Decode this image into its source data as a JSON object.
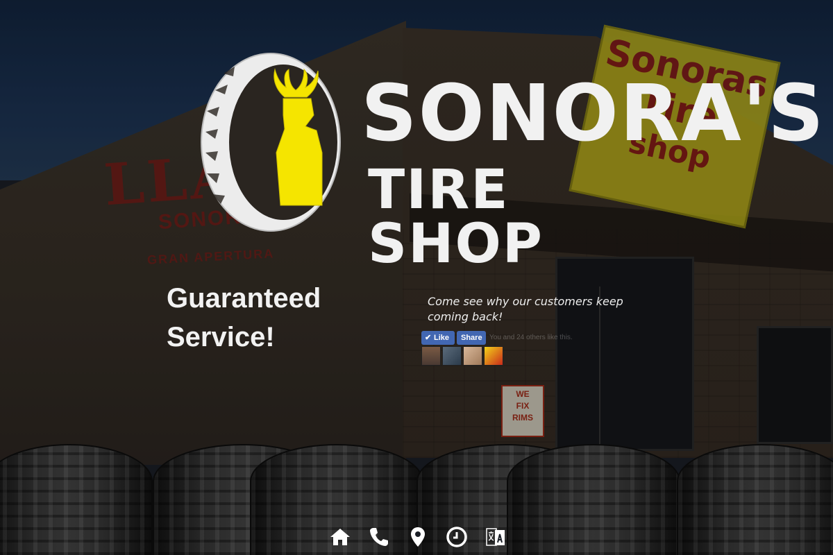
{
  "brand": {
    "name_line1": "SONORA'S",
    "name_line2": "TIRE SHOP",
    "accent_color": "#f5e500",
    "text_color": "#f1f1f1"
  },
  "background_text": {
    "wall_title": "LLAN",
    "wall_subtitle": "SONOR",
    "wall_note": "GRAN APERTURA",
    "sign_lines": [
      "Sonoras",
      "Tire",
      "shop"
    ],
    "rims_sign": [
      "WE",
      "FIX",
      "RIMS"
    ]
  },
  "hero": {
    "headline_line1": "Guaranteed",
    "headline_line2": "Service!",
    "tagline": "Come see why our customers keep coming back!"
  },
  "facebook": {
    "like_label": "Like",
    "share_label": "Share",
    "count_text": "You and 24 others like this.",
    "brand_color": "#4267b2"
  },
  "nav": {
    "items": [
      {
        "icon": "home-icon",
        "label": "Home"
      },
      {
        "icon": "phone-icon",
        "label": "Phone"
      },
      {
        "icon": "map-pin-icon",
        "label": "Location"
      },
      {
        "icon": "clock-icon",
        "label": "Hours"
      },
      {
        "icon": "translate-icon",
        "label": "Language"
      }
    ]
  }
}
